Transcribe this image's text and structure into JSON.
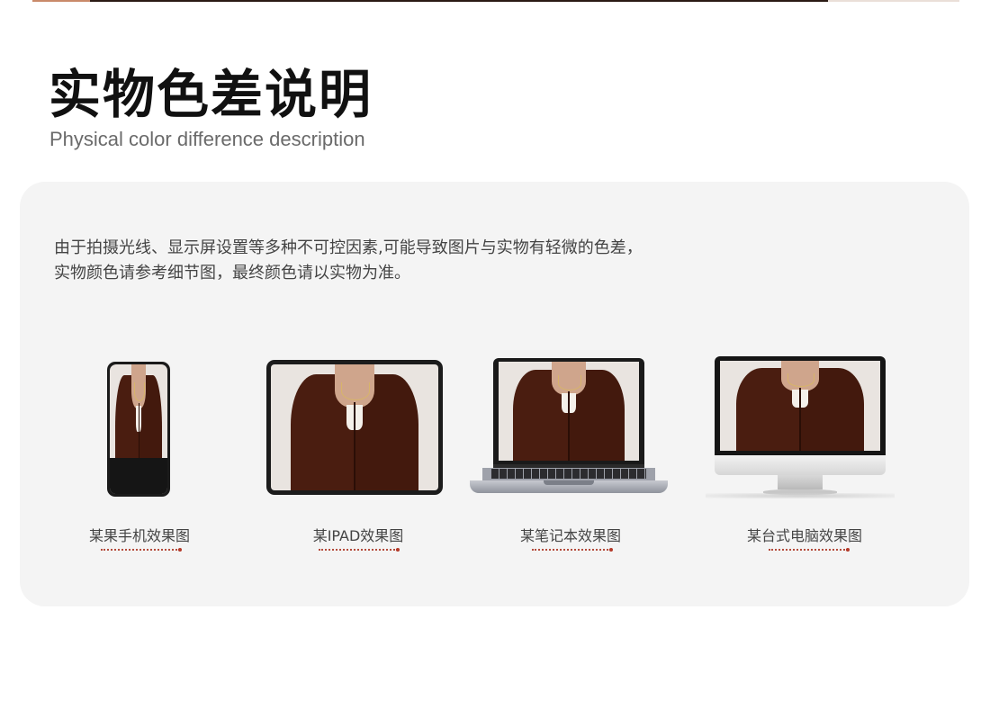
{
  "heading": {
    "title": "实物色差说明",
    "subtitle": "Physical color difference description"
  },
  "description": {
    "line1": "由于拍摄光线、显示屏设置等多种不可控因素,可能导致图片与实物有轻微的色差，",
    "line2": "实物颜色请参考细节图，最终颜色请以实物为准。"
  },
  "devices": [
    {
      "label": "某果手机效果图"
    },
    {
      "label": "某IPAD效果图"
    },
    {
      "label": "某笔记本效果图"
    },
    {
      "label": "某台式电脑效果图"
    }
  ],
  "colors": {
    "accent_dots": "#b44a3a",
    "panel_bg": "#f4f4f4",
    "jacket": "#4a1d10"
  }
}
